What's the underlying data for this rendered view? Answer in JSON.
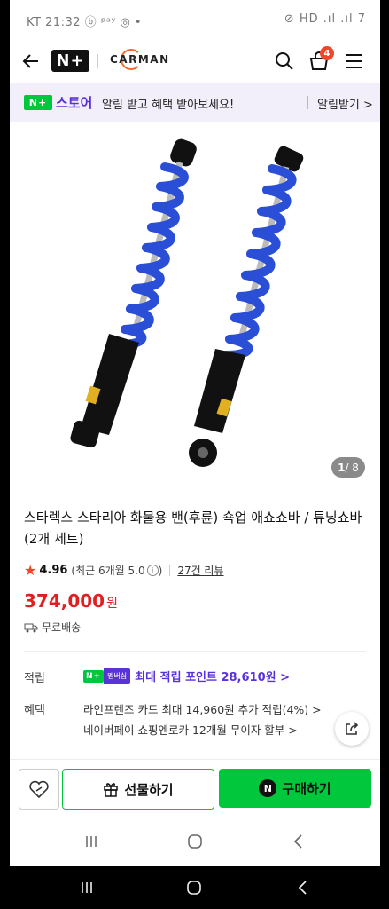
{
  "status": {
    "left": "KT 21:32 ⓑ ᵖᵃʸ ◎ •",
    "right": "⊘ HD .ıl .ıl 7"
  },
  "header": {
    "logo": "N+",
    "brand": "CARMAN",
    "cart_count": "4"
  },
  "banner": {
    "badge": "N+",
    "store": "스토어",
    "message": "알림 받고 혜택 받아보세요!",
    "link": "알림받기 >"
  },
  "gallery": {
    "current": "1",
    "total": " / 8"
  },
  "product": {
    "title": "스타렉스 스타리아 화물용 밴(후륜) 쇽업 애쇼쇼바 / 튜닝쇼바(2개 세트)",
    "rating": "4.96",
    "rating_note": "(최근 6개월 5.0",
    "rating_note_end": ")",
    "reviews": "27건 리뷰",
    "price": "374,000",
    "currency": "원",
    "shipping": "무료배송"
  },
  "points": {
    "label": "적립",
    "badge": "N+",
    "badge2": "멤버십",
    "text": "최대 적립 포인트 28,610원 >"
  },
  "benefits": {
    "label": "혜택",
    "items": [
      "라인프렌즈 카드 최대 14,960원 추가 적립(4%) >",
      "네이버페이 쇼핑엔로카 12개월 무이자 할부 >"
    ]
  },
  "actions": {
    "gift": "선물하기",
    "buy": "구매하기",
    "buy_mark": "N"
  },
  "colors": {
    "naver_green": "#00c73c",
    "store_purple": "#5a33d6",
    "price_red": "#e02020",
    "spring_blue": "#2a4fd6"
  }
}
